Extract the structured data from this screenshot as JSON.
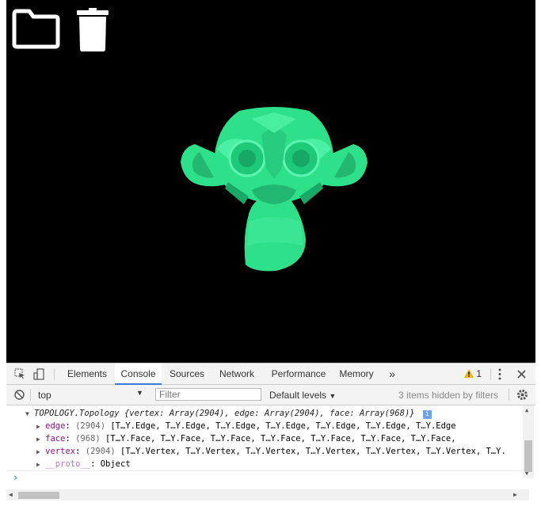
{
  "viewport": {
    "background": "#000000",
    "icons": [
      "folder-icon",
      "trash-icon"
    ],
    "model_color": "#2fe08a"
  },
  "devtools": {
    "tabs": [
      {
        "label": "Elements",
        "active": false
      },
      {
        "label": "Console",
        "active": true
      },
      {
        "label": "Sources",
        "active": false
      },
      {
        "label": "Network",
        "active": false
      },
      {
        "label": "Performance",
        "active": false
      },
      {
        "label": "Memory",
        "active": false
      }
    ],
    "more_tabs": "»",
    "warning_count": "1",
    "accent": "#3879d9"
  },
  "filterbar": {
    "context": "top",
    "filter_placeholder": "Filter",
    "levels": "Default levels",
    "hidden": "3 items hidden by filters"
  },
  "console": {
    "object_line": "TOPOLOGY.Topology {vertex: Array(2904), edge: Array(2904), face: Array(968)}",
    "rows": [
      {
        "key": "edge",
        "count": "(2904)",
        "value": "[T…Y.Edge, T…Y.Edge, T…Y.Edge, T…Y.Edge, T…Y.Edge, T…Y.Edge, T…Y.Edge"
      },
      {
        "key": "face",
        "count": "(968)",
        "value": "[T…Y.Face, T…Y.Face, T…Y.Face, T…Y.Face, T…Y.Face, T…Y.Face, T…Y.Face,"
      },
      {
        "key": "vertex",
        "count": "(2904)",
        "value": "[T…Y.Vertex, T…Y.Vertex, T…Y.Vertex, T…Y.Vertex, T…Y.Vertex, T…Y.Vertex, T…Y."
      }
    ],
    "proto_key": "__proto__",
    "proto_value": "Object",
    "prompt": "›"
  }
}
